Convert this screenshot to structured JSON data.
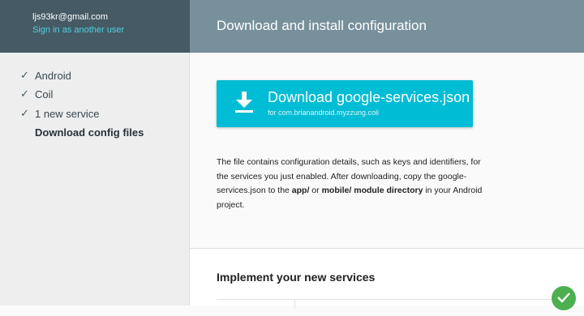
{
  "account": {
    "email": "ljs93kr@gmail.com",
    "switch_label": "Sign in as another user"
  },
  "steps": [
    {
      "label": "Android",
      "done": true
    },
    {
      "label": "Coil",
      "done": true
    },
    {
      "label": "1 new service",
      "done": true
    },
    {
      "label": "Download config files",
      "done": false,
      "active": true
    }
  ],
  "main": {
    "title": "Download and install configuration",
    "download": {
      "label": "Download google-services.json",
      "sub": "for com.brianandroid.myzzung.coli",
      "icon": "download-icon"
    },
    "description": {
      "part1": "The file contains configuration details, such as keys and identifiers, for the services you just enabled. After downloading, copy the google-services.json to the ",
      "bold1": "app/",
      "part2": " or ",
      "bold2": "mobile/ module directory",
      "part3": " in your Android project."
    }
  },
  "lower": {
    "title": "Implement your new services"
  },
  "colors": {
    "sidebar_header": "#455a64",
    "main_header": "#78909c",
    "accent": "#00bcd4",
    "link": "#4dd0e1",
    "success": "#4caf50"
  }
}
